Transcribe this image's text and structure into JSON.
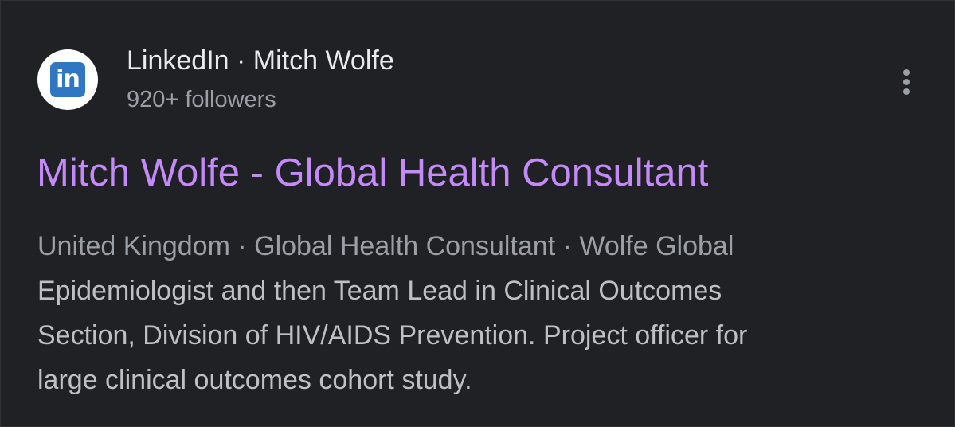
{
  "result": {
    "source_name": "LinkedIn",
    "separator": "·",
    "author": "Mitch Wolfe",
    "followers": "920+ followers",
    "logo_text": "in",
    "title": "Mitch Wolfe - Global Health Consultant",
    "meta_line": "United Kingdom · Global Health Consultant · Wolfe Global",
    "snippet_lines": [
      "Epidemiologist and then Team Lead in Clinical Outcomes",
      "Section, Division of HIV/AIDS Prevention. Project officer for",
      "large clinical outcomes cohort study."
    ]
  },
  "colors": {
    "background": "#202124",
    "title_link": "#c58af9",
    "primary_text": "#e8eaed",
    "secondary_text": "#9aa0a6",
    "snippet_text": "#bdc1c6",
    "linkedin_blue": "#2f76c3"
  },
  "icons": {
    "logo": "linkedin-logo-icon",
    "more": "more-vert-icon"
  }
}
